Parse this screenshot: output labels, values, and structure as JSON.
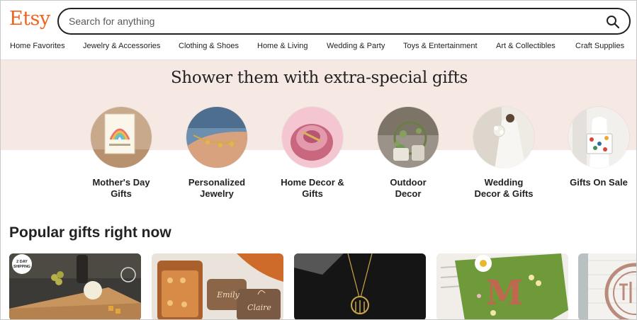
{
  "header": {
    "logo": "Etsy",
    "search_placeholder": "Search for anything"
  },
  "nav": {
    "items": [
      "Home Favorites",
      "Jewelry & Accessories",
      "Clothing & Shoes",
      "Home & Living",
      "Wedding & Party",
      "Toys & Entertainment",
      "Art & Collectibles",
      "Craft Supplies"
    ]
  },
  "hero": {
    "title": "Shower them with extra-special gifts",
    "categories": [
      {
        "line1": "Mother's Day",
        "line2": "Gifts"
      },
      {
        "line1": "Personalized",
        "line2": "Jewelry"
      },
      {
        "line1": "Home Decor &",
        "line2": "Gifts"
      },
      {
        "line1": "Outdoor",
        "line2": "Decor"
      },
      {
        "line1": "Wedding",
        "line2": "Decor & Gifts"
      },
      {
        "line1": "Gifts On Sale",
        "line2": ""
      }
    ]
  },
  "popular": {
    "title": "Popular gifts right now",
    "badge_line1": "2 DAY",
    "badge_line2": "SHIPPING",
    "box_name_1": "Emily",
    "box_name_2": "Claire",
    "pillow_letter": "M"
  },
  "colors": {
    "brand": "#f1641e",
    "hero_bg": "#f6e8e3",
    "text": "#222222"
  }
}
